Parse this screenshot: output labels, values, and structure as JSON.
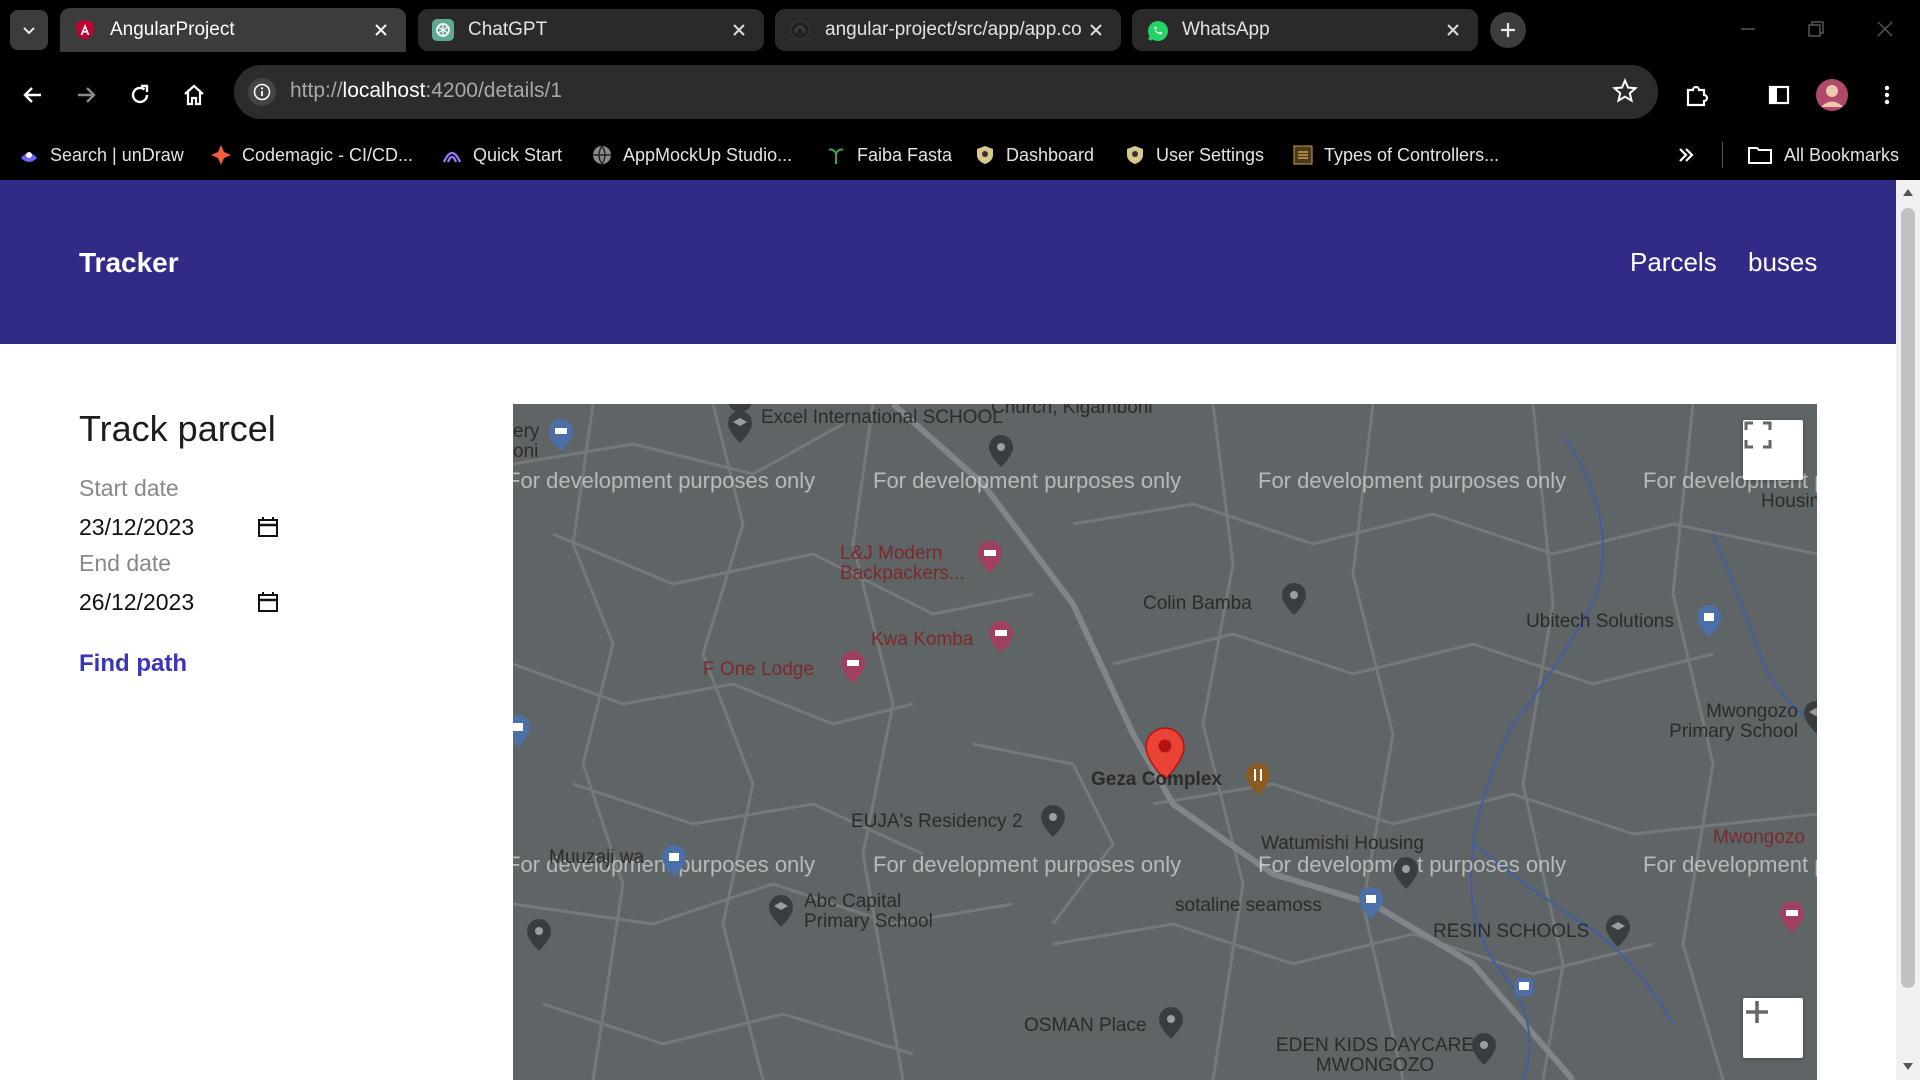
{
  "browser": {
    "tabs": [
      {
        "label": "AngularProject",
        "active": true,
        "icon": "angular-icon"
      },
      {
        "label": "ChatGPT",
        "active": false,
        "icon": "chatgpt-icon"
      },
      {
        "label": "angular-project/src/app/app.co",
        "active": false,
        "icon": "github-icon"
      },
      {
        "label": "WhatsApp",
        "active": false,
        "icon": "whatsapp-icon"
      }
    ],
    "url_prefix": "http://",
    "url_host": "localhost",
    "url_rest": ":4200/details/1",
    "bookmarks": [
      {
        "label": "Search | unDraw",
        "icon": "undraw-icon"
      },
      {
        "label": "Codemagic - CI/CD...",
        "icon": "codemagic-icon"
      },
      {
        "label": "Quick Start",
        "icon": "quickstart-icon"
      },
      {
        "label": "AppMockUp Studio...",
        "icon": "globe-icon"
      },
      {
        "label": "Faiba Fasta",
        "icon": "faiba-icon"
      },
      {
        "label": "Dashboard",
        "icon": "dashboard-icon"
      },
      {
        "label": "User Settings",
        "icon": "settings-bookmark-icon"
      },
      {
        "label": "Types of Controllers...",
        "icon": "e4u-icon"
      }
    ],
    "all_bookmarks_label": "All Bookmarks"
  },
  "header": {
    "brand": "Tracker",
    "nav": [
      "Parcels",
      "buses"
    ],
    "bg_color": "#312a87"
  },
  "sidebar": {
    "title": "Track parcel",
    "start_label": "Start date",
    "start_value": "23/12/2023",
    "end_label": "End date",
    "end_value": "26/12/2023",
    "find_button": "Find path"
  },
  "map": {
    "watermark": "For development purposes only",
    "places": [
      "Excel International SCHOOL",
      "Church, Kigamboni",
      "L&J Modern Backpackers...",
      "Colin Bamba",
      "Kwa Komba",
      "F One Lodge",
      "Ubitech Solutions",
      "Mwongozo Primary School",
      "Geza Complex",
      "EUJA's Residency 2",
      "Muuzaji wa",
      "Watumishi Housing",
      "sotaline seamoss",
      "Abc Capital Primary School",
      "RESIN SCHOOLS",
      "Mwongozo",
      "OSMAN Place",
      "EDEN KIDS DAYCARE MWONGOZO",
      "ery oni",
      "Housin"
    ]
  }
}
